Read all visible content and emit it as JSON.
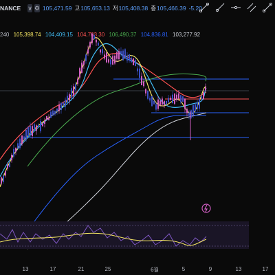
{
  "header": {
    "symbol": "NANCE",
    "btn_expand": "∨",
    "btn_settings": "⚙",
    "open_label": "",
    "open_value": "105,471.59",
    "high_label": "고",
    "high_value": "105,653.13",
    "low_label": "저",
    "low_value": "105,408.38",
    "close_label": "종",
    "close_value": "105,466.39",
    "change": "-5.20"
  },
  "ma_values": [
    {
      "text": "240",
      "color": "#b2b5be"
    },
    {
      "text": "105,398.74",
      "color": "#f5e663"
    },
    {
      "text": "104,409.15",
      "color": "#42bdf5"
    },
    {
      "text": "104,703.30",
      "color": "#ff5252"
    },
    {
      "text": "106,490.37",
      "color": "#4caf50"
    },
    {
      "text": "104,836.81",
      "color": "#2962ff"
    },
    {
      "text": "103,277.92",
      "color": "#d1d4dc"
    }
  ],
  "toolbar": {
    "icons": [
      "trend-line-icon",
      "ray-icon",
      "horizontal-line-icon",
      "parallel-channel-icon",
      "fib-icon"
    ]
  },
  "x_axis": {
    "labels": [
      "13",
      "17",
      "21",
      "25",
      "6월",
      "5",
      "9",
      "13",
      "17"
    ]
  },
  "colors": {
    "up": "#d05ec2",
    "down": "#3a4fc4",
    "ma_yellow": "#f5e663",
    "ma_cyan": "#42bdf5",
    "ma_red": "#ff5252",
    "ma_green": "#4caf50",
    "ma_blue": "#2962ff",
    "ma_white": "#d1d4dc",
    "level_blue": "#2962ff",
    "level_red": "#ff5252",
    "rsi_line": "#7e57c2",
    "rsi_signal": "#f5e663",
    "alert": "#d05ec2"
  }
}
